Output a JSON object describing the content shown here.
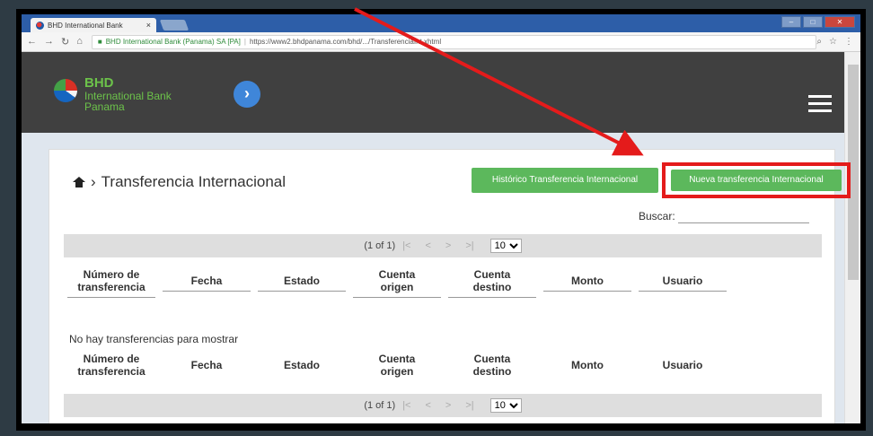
{
  "browser": {
    "tab_title": "BHD International Bank",
    "url_secure_label": "BHD International Bank (Panama) SA [PA]",
    "url": "https://www2.bhdpanama.com/bhd/.../TransferenciaInt.xhtml"
  },
  "header": {
    "brand_line1": "BHD",
    "brand_line2": "International Bank",
    "brand_line3": "Panama"
  },
  "page": {
    "title": "Transferencia Internacional",
    "btn_history": "Histórico Transferencia Internacional",
    "btn_new": "Nueva transferencia Internacional",
    "search_label": "Buscar:",
    "search_value": "",
    "empty_message": "No hay transferencias para mostrar"
  },
  "pager": {
    "status": "(1 of 1)",
    "first": "|<",
    "prev": "<",
    "next": ">",
    "last": ">|",
    "rows": "10"
  },
  "columns": [
    [
      "Número de",
      "transferencia"
    ],
    [
      "Fecha",
      ""
    ],
    [
      "Estado",
      ""
    ],
    [
      "Cuenta",
      "origen"
    ],
    [
      "Cuenta",
      "destino"
    ],
    [
      "Monto",
      ""
    ],
    [
      "Usuario",
      ""
    ]
  ],
  "colors": {
    "green_button": "#5cb85c",
    "highlight_red": "#e41b1b",
    "header_bg": "#404040",
    "brand_green": "#6cc24a"
  }
}
